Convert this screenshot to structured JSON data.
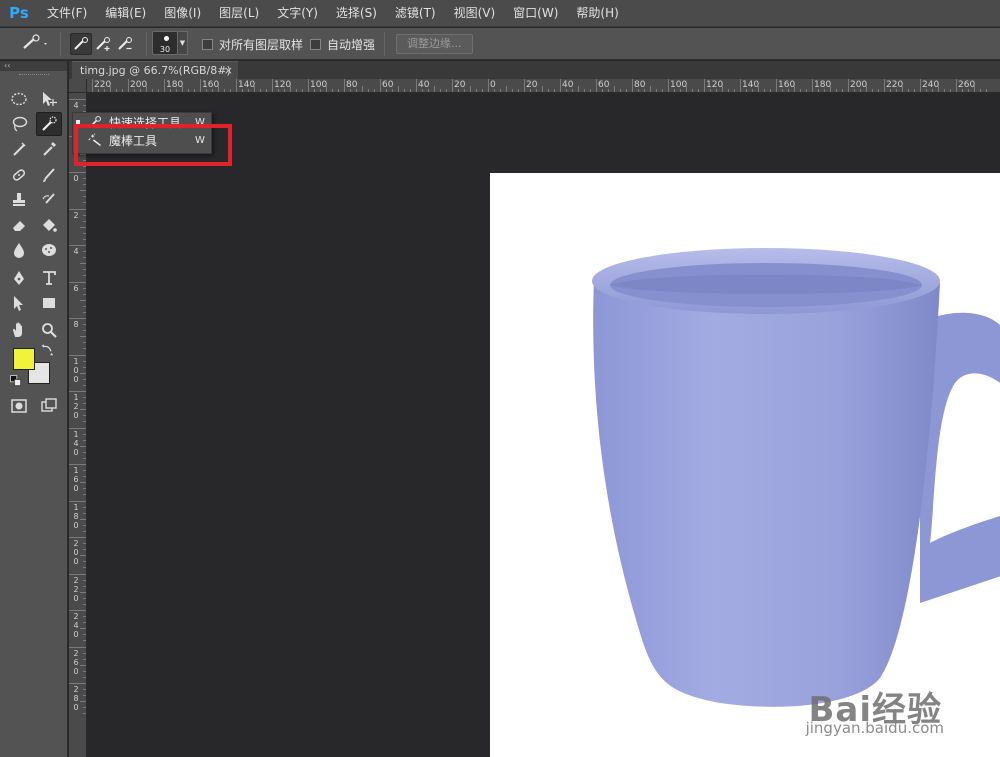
{
  "app": {
    "logo": "Ps",
    "menu": [
      "文件(F)",
      "编辑(E)",
      "图像(I)",
      "图层(L)",
      "文字(Y)",
      "选择(S)",
      "滤镜(T)",
      "视图(V)",
      "窗口(W)",
      "帮助(H)"
    ]
  },
  "options": {
    "brush_size": "30",
    "sample_all_layers": "对所有图层取样",
    "auto_enhance": "自动增强",
    "refine_edge": "调整边缘..."
  },
  "toolbox": {
    "collapse": "‹‹",
    "foreground_color": "#f1f23a",
    "background_color": "#e5e5e5"
  },
  "document": {
    "tab_title": "timg.jpg @ 66.7%(RGB/8#)",
    "close": "×"
  },
  "ruler": {
    "top_labels": [
      "220",
      "200",
      "180",
      "160",
      "140",
      "120",
      "100",
      "80",
      "60",
      "40",
      "20",
      "0",
      "20",
      "40",
      "60",
      "80",
      "100",
      "120",
      "140",
      "160",
      "180",
      "200",
      "220",
      "240",
      "260"
    ],
    "left_labels": [
      "4",
      "2",
      "0",
      "2",
      "4",
      "6",
      "8",
      "100",
      "120",
      "140",
      "160",
      "180",
      "200",
      "220",
      "240",
      "260",
      "280"
    ]
  },
  "flyout": {
    "items": [
      {
        "label": "快速选择工具",
        "shortcut": "W"
      },
      {
        "label": "魔棒工具",
        "shortcut": "W"
      }
    ]
  },
  "watermark": {
    "brand": "Bai经验",
    "url": "jingyan.baidu.com"
  }
}
